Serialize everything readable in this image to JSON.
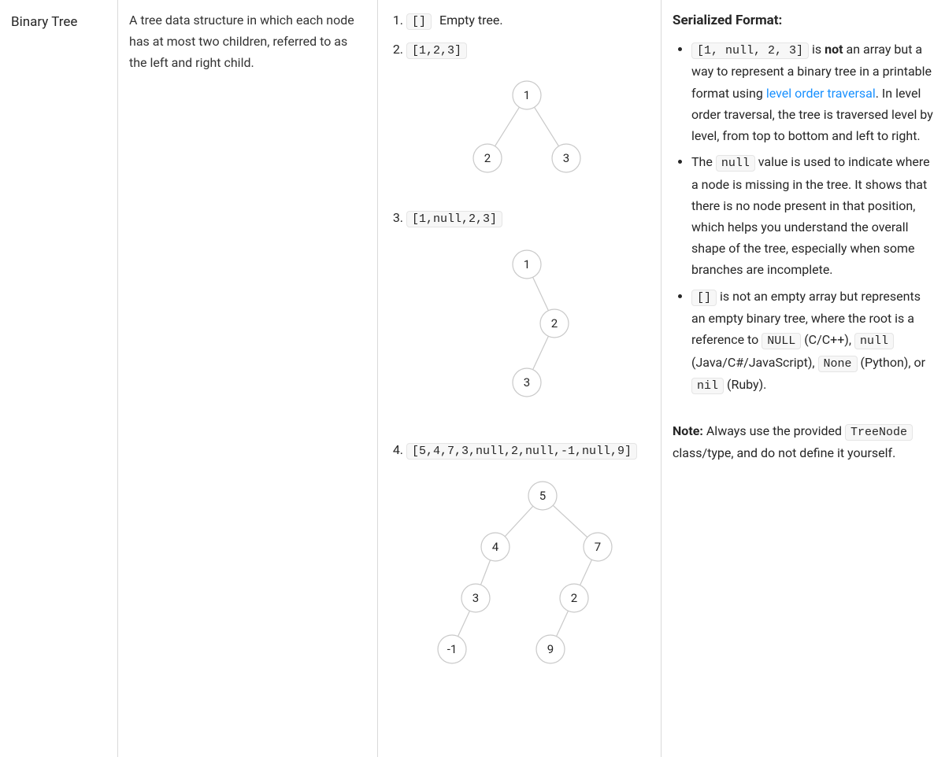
{
  "term": "Binary Tree",
  "definition": "A tree data structure in which each node has at most two children, referred to as the left and right child.",
  "examples": {
    "item1_code": "[]",
    "item1_text": "Empty tree.",
    "item2_code": "[1,2,3]",
    "item3_code": "[1,null,2,3]",
    "item4_code": "[5,4,7,3,null,2,null,-1,null,9]"
  },
  "tree2": {
    "n1": "1",
    "n2": "2",
    "n3": "3"
  },
  "tree3": {
    "n1": "1",
    "n2": "2",
    "n3": "3"
  },
  "tree4": {
    "n5": "5",
    "n4": "4",
    "n7": "7",
    "n3": "3",
    "n2": "2",
    "nm1": "-1",
    "n9": "9"
  },
  "serialized": {
    "heading": "Serialized Format:",
    "b1_code": "[1, null, 2, 3]",
    "b1_a": " is ",
    "b1_not": "not",
    "b1_b": " an array but a way to represent a binary tree in a printable format using ",
    "b1_link": "level order traversal",
    "b1_c": ". In level order traversal, the tree is traversed level by level, from top to bottom and left to right.",
    "b2_a": "The ",
    "b2_code": "null",
    "b2_b": " value is used to indicate where a node is missing in the tree. It shows that there is no node present in that position, which helps you understand the overall shape of the tree, especially when some branches are incomplete.",
    "b3_code": "[]",
    "b3_a": " is not an empty array but represents an empty binary tree, where the root is a reference to ",
    "b3_null": "NULL",
    "b3_b": " (C/C++), ",
    "b3_null2": "null",
    "b3_c": " (Java/C#/JavaScript), ",
    "b3_none": "None",
    "b3_d": " (Python), or ",
    "b3_nil": "nil",
    "b3_e": " (Ruby)."
  },
  "note": {
    "label": "Note:",
    "a": " Always use the provided ",
    "code": "TreeNode",
    "b": " class/type, and do not define it yourself."
  }
}
